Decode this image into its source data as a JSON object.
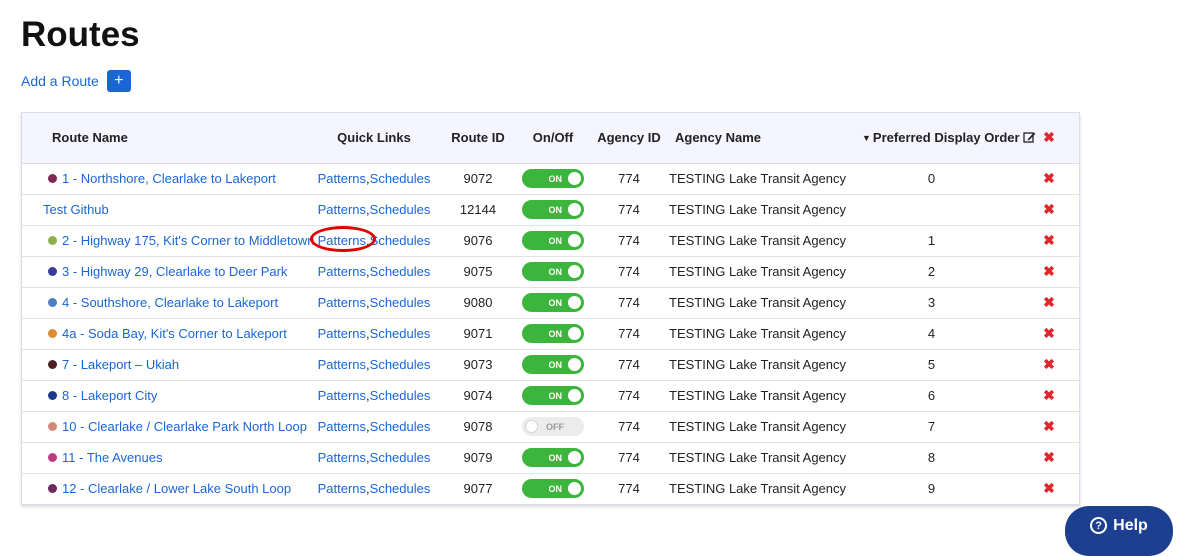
{
  "page": {
    "title": "Routes"
  },
  "add_route": {
    "label": "Add a Route",
    "button_icon": "+"
  },
  "table": {
    "columns": {
      "route_name": "Route Name",
      "quick_links": "Quick Links",
      "route_id": "Route ID",
      "on_off": "On/Off",
      "agency_id": "Agency ID",
      "agency_name": "Agency Name",
      "preferred_display_order": "Preferred Display Order"
    },
    "header_delete_icon": "✖",
    "quick_links": {
      "patterns": "Patterns",
      "separator": ",",
      "schedules": "Schedules"
    },
    "toggle_labels": {
      "on": "ON",
      "off": "OFF"
    },
    "delete_icon": "✖",
    "rows": [
      {
        "color": "#7a2a55",
        "name": "1 - Northshore, Clearlake to Lakeport",
        "route_id": "9072",
        "on": true,
        "agency_id": "774",
        "agency_name": "TESTING Lake Transit Agency",
        "order": "0"
      },
      {
        "color": "",
        "name": "Test Github",
        "route_id": "12144",
        "on": true,
        "agency_id": "774",
        "agency_name": "TESTING Lake Transit Agency",
        "order": ""
      },
      {
        "color": "#8fb04a",
        "name": "2 - Highway 175, Kit's Corner to Middletown",
        "route_id": "9076",
        "on": true,
        "agency_id": "774",
        "agency_name": "TESTING Lake Transit Agency",
        "order": "1"
      },
      {
        "color": "#3a3a9a",
        "name": "3 - Highway 29, Clearlake to Deer Park",
        "route_id": "9075",
        "on": true,
        "agency_id": "774",
        "agency_name": "TESTING Lake Transit Agency",
        "order": "2"
      },
      {
        "color": "#4f7fc0",
        "name": "4 - Southshore, Clearlake to Lakeport",
        "route_id": "9080",
        "on": true,
        "agency_id": "774",
        "agency_name": "TESTING Lake Transit Agency",
        "order": "3"
      },
      {
        "color": "#e08a30",
        "name": "4a - Soda Bay, Kit's Corner to Lakeport",
        "route_id": "9071",
        "on": true,
        "agency_id": "774",
        "agency_name": "TESTING Lake Transit Agency",
        "order": "4"
      },
      {
        "color": "#4a2020",
        "name": "7 - Lakeport – Ukiah",
        "route_id": "9073",
        "on": true,
        "agency_id": "774",
        "agency_name": "TESTING Lake Transit Agency",
        "order": "5"
      },
      {
        "color": "#1d3a8a",
        "name": "8 - Lakeport City",
        "route_id": "9074",
        "on": true,
        "agency_id": "774",
        "agency_name": "TESTING Lake Transit Agency",
        "order": "6"
      },
      {
        "color": "#d08a7a",
        "name": "10 - Clearlake / Clearlake Park North Loop",
        "route_id": "9078",
        "on": false,
        "agency_id": "774",
        "agency_name": "TESTING Lake Transit Agency",
        "order": "7"
      },
      {
        "color": "#c03a80",
        "name": "11 - The Avenues",
        "route_id": "9079",
        "on": true,
        "agency_id": "774",
        "agency_name": "TESTING Lake Transit Agency",
        "order": "8"
      },
      {
        "color": "#6a2a5a",
        "name": "12 - Clearlake / Lower Lake South Loop",
        "route_id": "9077",
        "on": true,
        "agency_id": "774",
        "agency_name": "TESTING Lake Transit Agency",
        "order": "9"
      }
    ]
  },
  "help": {
    "label": "Help",
    "icon": "?"
  },
  "colors": {
    "link": "#1a66d6",
    "toggle_on": "#3bb53b",
    "delete": "#e3242b",
    "help_bg": "#1d3f8f",
    "annotation": "#e10000"
  }
}
